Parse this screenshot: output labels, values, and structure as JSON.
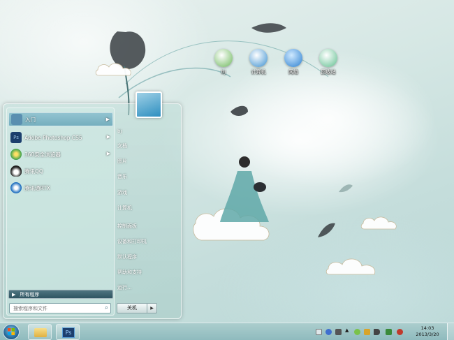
{
  "desktop": {
    "icons": [
      {
        "name": "desktop-icon-bj",
        "label": "bj",
        "icon": "library-icon",
        "color": "#6cb85a"
      },
      {
        "name": "desktop-icon-computer",
        "label": "计算机",
        "icon": "computer-icon",
        "color": "#3a8fd0"
      },
      {
        "name": "desktop-icon-network",
        "label": "网络",
        "icon": "globe-icon",
        "color": "#2b7fd0"
      },
      {
        "name": "desktop-icon-recycle-bin",
        "label": "回收站",
        "icon": "recycle-bin-icon",
        "color": "#5fbf8f"
      }
    ]
  },
  "start_menu": {
    "programs": [
      {
        "label": "入门",
        "icon": "getting-started-icon",
        "color": "#5a8fb0",
        "has_arrow": true,
        "highlight": true
      },
      {
        "label": "Adobe Photoshop CS5",
        "icon": "photoshop-icon",
        "color": "#1c3f6e",
        "has_arrow": true,
        "highlight": false
      },
      {
        "label": "360安全浏览器",
        "icon": "360-browser-icon",
        "color": "#3aa04a",
        "has_arrow": true,
        "highlight": false
      },
      {
        "label": "腾讯QQ",
        "icon": "qq-penguin-icon",
        "color": "#222222",
        "has_arrow": false,
        "highlight": false
      },
      {
        "label": "腾讯通RTX",
        "icon": "rtx-icon",
        "color": "#1f6fbf",
        "has_arrow": false,
        "highlight": false
      }
    ],
    "all_programs_label": "所有程序",
    "search_placeholder": "搜索程序和文件",
    "right_items": [
      "bj",
      "文档",
      "图片",
      "音乐",
      "游戏",
      "计算机",
      "控制面板",
      "设备和打印机",
      "默认程序",
      "帮助和支持",
      "运行..."
    ],
    "shutdown_label": "关机",
    "shutdown_more": "▶"
  },
  "taskbar": {
    "pinned": [
      {
        "name": "taskbar-explorer-button",
        "icon": "folder-icon",
        "color": "#e8c25a"
      },
      {
        "name": "taskbar-photoshop-button",
        "icon": "photoshop-icon",
        "color": "#1c3f6e",
        "text": "Ps"
      }
    ],
    "tray": [
      "keyboard-icon",
      "help-icon",
      "flag-icon",
      "chevron-up-icon",
      "network-icon",
      "shield-icon",
      "volume-icon",
      "people-icon",
      "power-icon"
    ],
    "clock_time": "14:03",
    "clock_date": "2013/3/20"
  },
  "colors": {
    "accent": "#2f5562",
    "taskbar": "#a6cdce"
  }
}
